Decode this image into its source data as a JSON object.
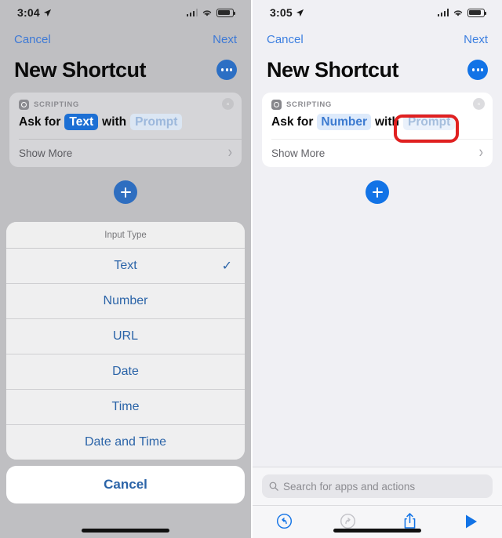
{
  "panels": [
    {
      "id": "left",
      "status": {
        "time": "3:04",
        "location_icon": "location-arrow-icon",
        "signal_icon": "cellular-signal-icon",
        "wifi_icon": "wifi-icon",
        "battery_icon": "battery-icon"
      },
      "nav": {
        "cancel": "Cancel",
        "next": "Next"
      },
      "title": "New Shortcut",
      "more_button": "more-options-icon",
      "card": {
        "category": "SCRIPTING",
        "close_icon": "close-circle-icon",
        "text_prefix": "Ask for",
        "type_value": "Text",
        "text_middle": "with",
        "prompt_value": "Prompt",
        "show_more": "Show More",
        "chevron": "›"
      },
      "add_button": "add-action-icon",
      "sheet": {
        "title": "Input Type",
        "options": [
          {
            "label": "Text",
            "checked": true
          },
          {
            "label": "Number",
            "checked": false
          },
          {
            "label": "URL",
            "checked": false
          },
          {
            "label": "Date",
            "checked": false
          },
          {
            "label": "Time",
            "checked": false
          },
          {
            "label": "Date and Time",
            "checked": false
          }
        ],
        "cancel": "Cancel",
        "check_glyph": "✓"
      }
    },
    {
      "id": "right",
      "status": {
        "time": "3:05",
        "location_icon": "location-arrow-icon",
        "signal_icon": "cellular-signal-icon",
        "wifi_icon": "wifi-icon",
        "battery_icon": "battery-icon"
      },
      "nav": {
        "cancel": "Cancel",
        "next": "Next"
      },
      "title": "New Shortcut",
      "more_button": "more-options-icon",
      "card": {
        "category": "SCRIPTING",
        "close_icon": "close-circle-icon",
        "text_prefix": "Ask for",
        "type_value": "Number",
        "text_middle": "with",
        "prompt_value": "Prompt",
        "show_more": "Show More",
        "chevron": "›"
      },
      "add_button": "add-action-icon",
      "search": {
        "placeholder": "Search for apps and actions",
        "icon": "search-icon"
      },
      "toolbar": {
        "undo": "undo-icon",
        "redo": "redo-icon",
        "share": "share-icon",
        "play": "play-icon"
      },
      "annotation": {
        "shape": "rounded-rect",
        "color": "#e02020",
        "target": "Prompt"
      }
    }
  ],
  "colors": {
    "accent_blue": "#1273e6",
    "link_blue": "#3d79d6",
    "sheet_blue": "#2b64a8",
    "annotation_red": "#e02020",
    "dim_overlay": "#bfbfc2",
    "panel_bg": "#f0f0f4"
  }
}
